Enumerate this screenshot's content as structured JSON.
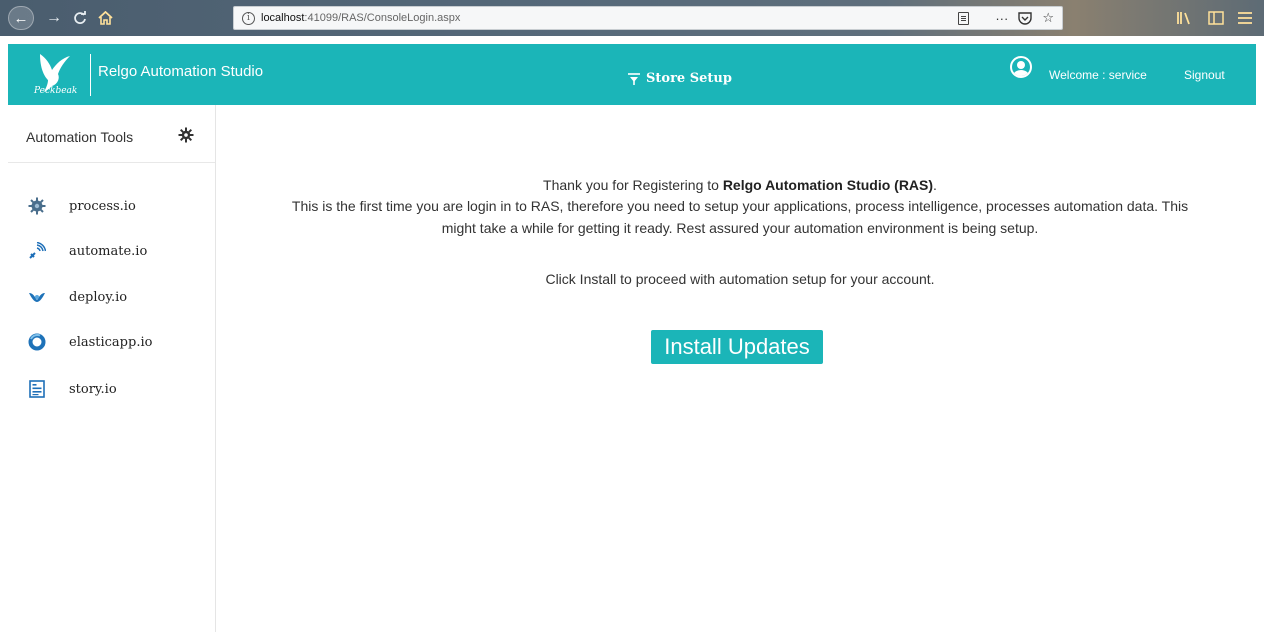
{
  "browser": {
    "url_host": "localhost",
    "url_path": ":41099/RAS/ConsoleLogin.aspx",
    "actions": "···"
  },
  "header": {
    "logo_text": "Peckbeak",
    "app_title": "Relgo Automation Studio",
    "store_setup": "Store Setup",
    "welcome": "Welcome : service",
    "signout": "Signout",
    "accent": "#1bb5b8"
  },
  "sidebar": {
    "title": "Automation Tools",
    "items": [
      {
        "label": "process.io",
        "icon": "gear-cluster-icon"
      },
      {
        "label": "automate.io",
        "icon": "signal-icon"
      },
      {
        "label": "deploy.io",
        "icon": "deploy-icon"
      },
      {
        "label": "elasticapp.io",
        "icon": "ring-icon"
      },
      {
        "label": "story.io",
        "icon": "document-icon"
      }
    ]
  },
  "main": {
    "thank_prefix": "Thank you for Registering to ",
    "thank_bold": "Relgo Automation Studio (RAS)",
    "thank_suffix": ".",
    "line2": "This is the first time you are login in to RAS, therefore you need to setup your applications, process intelligence, processes automation data. This",
    "line3": "might take a while for getting it ready. Rest assured your automation environment is being setup.",
    "line4": "Click Install to proceed with automation setup for your account.",
    "install_label": "Install Updates"
  }
}
